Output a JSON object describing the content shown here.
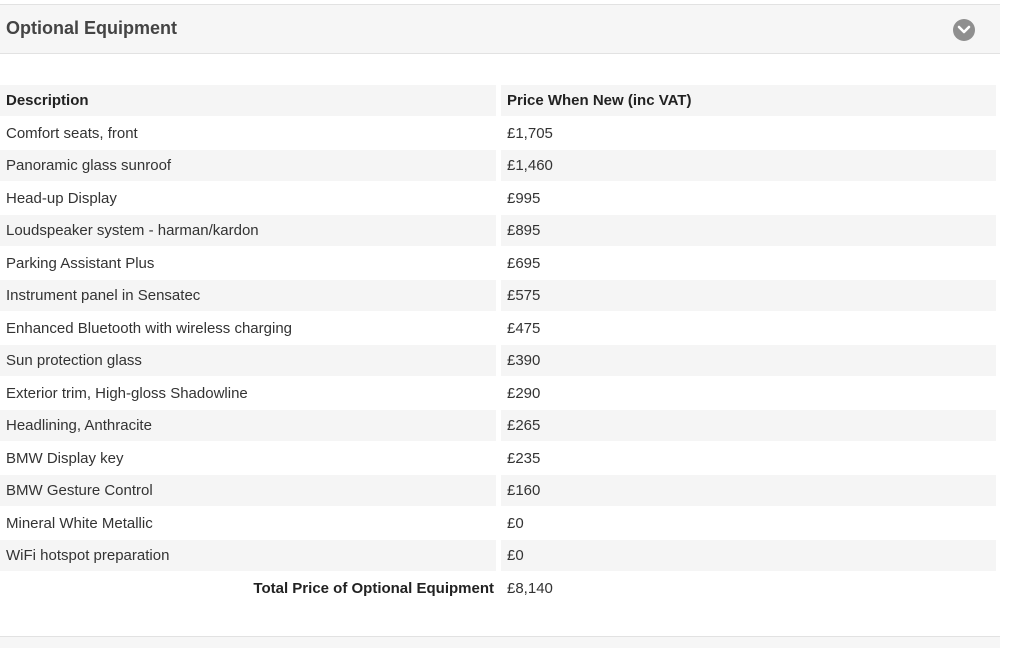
{
  "panel": {
    "title": "Optional Equipment",
    "toggle_icon": "chevron-down-icon"
  },
  "table": {
    "headers": [
      "Description",
      "Price When New (inc VAT)"
    ],
    "rows": [
      {
        "description": "Comfort seats, front",
        "price": "£1,705"
      },
      {
        "description": "Panoramic glass sunroof",
        "price": "£1,460"
      },
      {
        "description": "Head-up Display",
        "price": "£995"
      },
      {
        "description": "Loudspeaker system - harman/kardon",
        "price": "£895"
      },
      {
        "description": "Parking Assistant Plus",
        "price": "£695"
      },
      {
        "description": "Instrument panel in Sensatec",
        "price": "£575"
      },
      {
        "description": "Enhanced Bluetooth with wireless charging",
        "price": "£475"
      },
      {
        "description": "Sun protection glass",
        "price": "£390"
      },
      {
        "description": "Exterior trim, High-gloss Shadowline",
        "price": "£290"
      },
      {
        "description": "Headlining, Anthracite",
        "price": "£265"
      },
      {
        "description": "BMW Display key",
        "price": "£235"
      },
      {
        "description": "BMW Gesture Control",
        "price": "£160"
      },
      {
        "description": "Mineral White Metallic",
        "price": "£0"
      },
      {
        "description": "WiFi hotspot preparation",
        "price": "£0"
      }
    ],
    "total_label": "Total Price of Optional Equipment",
    "total_value": "£8,140"
  },
  "colors": {
    "header_bg": "#f6f6f6",
    "stripe_bg": "#f5f5f5",
    "toggle_bg": "#8f8f8f"
  }
}
